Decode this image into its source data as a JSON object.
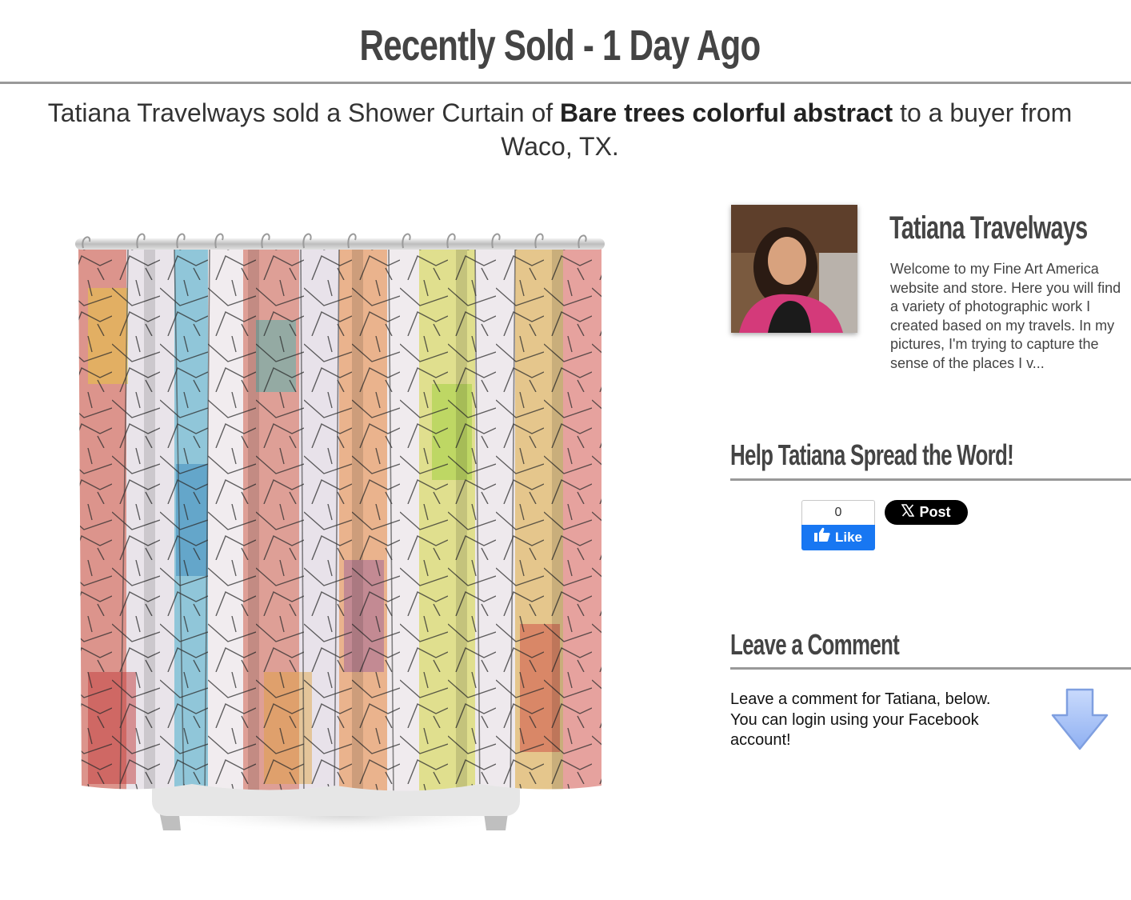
{
  "page": {
    "title": "Recently Sold - 1 Day Ago"
  },
  "headline": {
    "prefix": "Tatiana Travelways sold a Shower Curtain of ",
    "artwork_title": "Bare trees colorful abstract",
    "suffix": " to a buyer from Waco, TX."
  },
  "product": {
    "image_icon": "shower-curtain-image"
  },
  "artist": {
    "name": "Tatiana Travelways",
    "photo_icon": "artist-avatar",
    "bio": "Welcome to my Fine Art America website and store. Here you will find a variety of photographic work I created based on my travels. In my pictures, I'm trying to capture the sense of the places I v..."
  },
  "share": {
    "heading": "Help Tatiana Spread the Word!",
    "like_count": "0",
    "like_label": "Like",
    "post_label": "Post"
  },
  "comment": {
    "heading": "Leave a Comment",
    "text": "Leave a comment for Tatiana, below.   You can login using your Facebook account!",
    "arrow_icon": "down-arrow-icon"
  },
  "colors": {
    "rule": "#999999",
    "facebook_blue": "#1877f2",
    "x_black": "#000000",
    "arrow_blue": "#9bb8f5"
  }
}
